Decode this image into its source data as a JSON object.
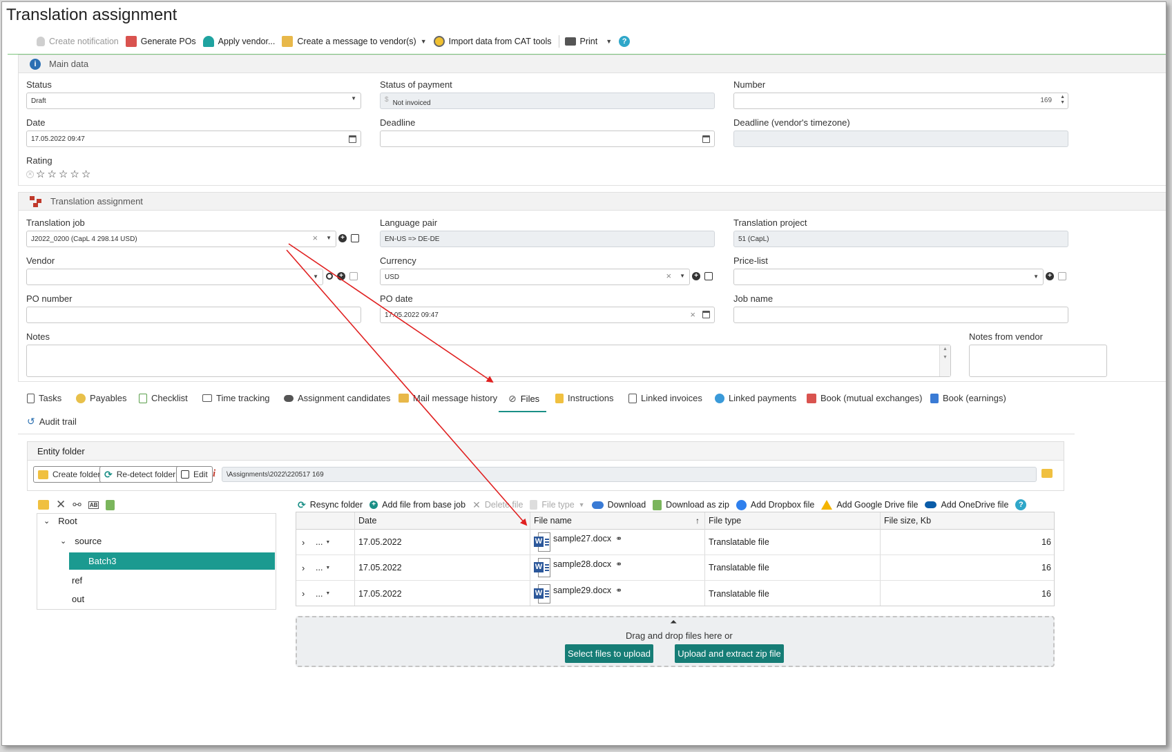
{
  "page": {
    "title": "Translation assignment"
  },
  "toolbar": {
    "create_notification": "Create notification",
    "generate_pos": "Generate POs",
    "apply_vendor": "Apply vendor...",
    "create_message": "Create a message to vendor(s)",
    "import_cat": "Import data from CAT tools",
    "print": "Print"
  },
  "main_data": {
    "header": "Main data",
    "status": {
      "label": "Status",
      "value": "Draft"
    },
    "status_of_payment": {
      "label": "Status of payment",
      "value": "Not invoiced"
    },
    "number": {
      "label": "Number",
      "value": "169"
    },
    "date": {
      "label": "Date",
      "value": "17.05.2022 09:47"
    },
    "deadline": {
      "label": "Deadline",
      "value": ""
    },
    "deadline_vendor": {
      "label": "Deadline (vendor's timezone)",
      "value": ""
    },
    "rating": {
      "label": "Rating",
      "stars": 0,
      "max": 5
    }
  },
  "assignment": {
    "header": "Translation assignment",
    "translation_job": {
      "label": "Translation job",
      "value": "J2022_0200 (CapL 4 298.14 USD)"
    },
    "language_pair": {
      "label": "Language pair",
      "value": "EN-US => DE-DE"
    },
    "translation_project": {
      "label": "Translation project",
      "value": "51 (CapL)"
    },
    "vendor": {
      "label": "Vendor",
      "value": ""
    },
    "currency": {
      "label": "Currency",
      "value": "USD"
    },
    "price_list": {
      "label": "Price-list",
      "value": ""
    },
    "po_number": {
      "label": "PO number",
      "value": ""
    },
    "po_date": {
      "label": "PO date",
      "value": "17.05.2022 09:47"
    },
    "job_name": {
      "label": "Job name",
      "value": ""
    },
    "notes": {
      "label": "Notes",
      "value": ""
    },
    "notes_from_vendor": {
      "label": "Notes from vendor",
      "value": ""
    }
  },
  "tabs": [
    {
      "label": "Tasks",
      "icon": "tasks-icon"
    },
    {
      "label": "Payables",
      "icon": "payables-icon"
    },
    {
      "label": "Checklist",
      "icon": "checklist-icon"
    },
    {
      "label": "Time tracking",
      "icon": "time-tracking-icon"
    },
    {
      "label": "Assignment candidates",
      "icon": "candidates-icon"
    },
    {
      "label": "Mail message history",
      "icon": "mail-icon"
    },
    {
      "label": "Files",
      "icon": "paperclip-icon",
      "active": true
    },
    {
      "label": "Instructions",
      "icon": "instructions-icon"
    },
    {
      "label": "Linked invoices",
      "icon": "invoice-icon"
    },
    {
      "label": "Linked payments",
      "icon": "payments-icon"
    },
    {
      "label": "Book (mutual exchanges)",
      "icon": "book-exchange-icon"
    },
    {
      "label": "Book (earnings)",
      "icon": "book-earnings-icon"
    },
    {
      "label": "Audit trail",
      "icon": "audit-icon"
    }
  ],
  "entity_folder": {
    "header": "Entity folder",
    "create_folder": "Create folder",
    "redetect_folder": "Re-detect folder",
    "edit": "Edit",
    "path": "\\Assignments\\2022\\220517 169"
  },
  "tree": {
    "root": "Root",
    "source": "source",
    "batch": "Batch3",
    "ref": "ref",
    "out": "out"
  },
  "files_toolbar": {
    "resync": "Resync folder",
    "add_from_base": "Add file from base job",
    "delete": "Delete file",
    "file_type": "File type",
    "download": "Download",
    "download_zip": "Download as zip",
    "add_dropbox": "Add Dropbox file",
    "add_gdrive": "Add Google Drive file",
    "add_onedrive": "Add OneDrive file"
  },
  "grid": {
    "columns": [
      "Date",
      "File name",
      "File type",
      "File size, Kb"
    ],
    "rows": [
      {
        "date": "17.05.2022",
        "name": "sample27.docx",
        "type": "Translatable file",
        "size": "16"
      },
      {
        "date": "17.05.2022",
        "name": "sample28.docx",
        "type": "Translatable file",
        "size": "16"
      },
      {
        "date": "17.05.2022",
        "name": "sample29.docx",
        "type": "Translatable file",
        "size": "16"
      }
    ],
    "row_menu": "..."
  },
  "dropzone": {
    "text": "Drag and drop files here or",
    "select_btn": "Select files to upload",
    "zip_btn": "Upload and extract zip file"
  },
  "colors": {
    "accent": "#1b9a90",
    "arrow": "#e02020",
    "green_line": "#7cc47c"
  }
}
